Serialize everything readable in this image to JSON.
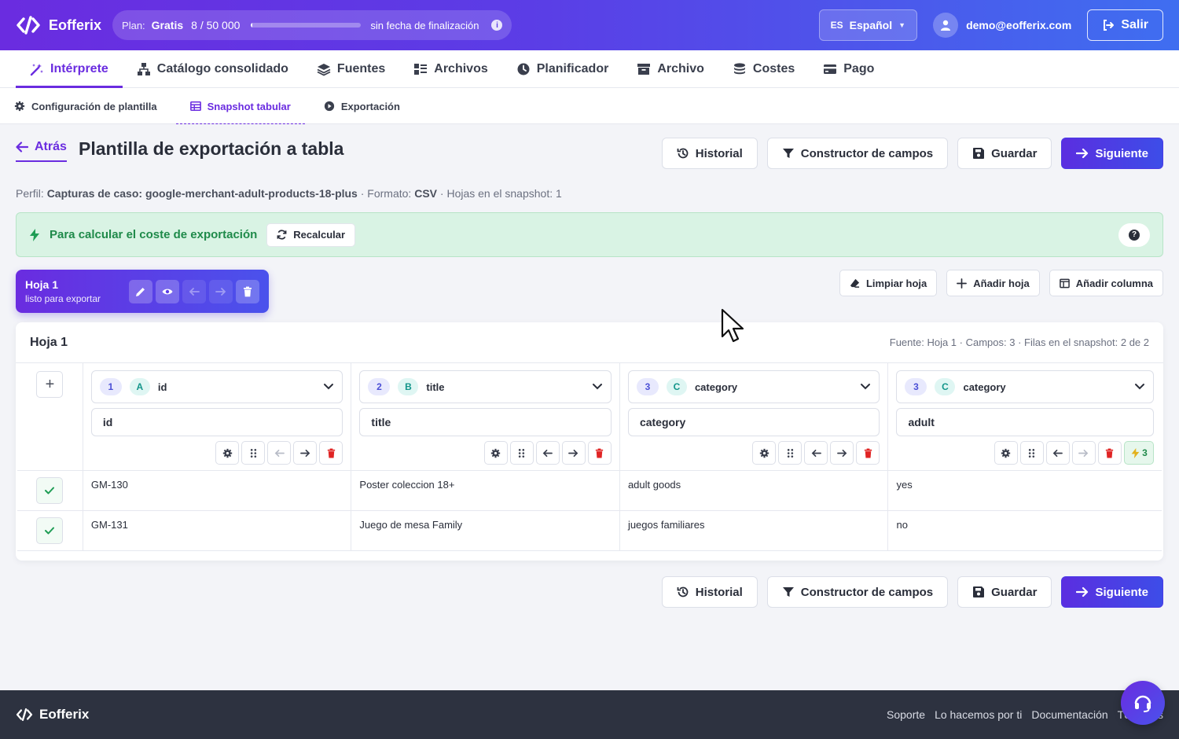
{
  "app": {
    "name": "Eofferix"
  },
  "plan": {
    "label": "Plan:",
    "name": "Gratis",
    "count": "8 / 50 000",
    "usage_fraction": 0.0002,
    "expiry": "sin fecha de finalización"
  },
  "language": {
    "code": "ES",
    "name": "Español"
  },
  "user": {
    "email": "demo@eofferix.com",
    "logout": "Salir"
  },
  "main_nav": [
    {
      "label": "Intérprete",
      "icon": "magic-wand-icon",
      "active": true
    },
    {
      "label": "Catálogo consolidado",
      "icon": "sitemap-icon"
    },
    {
      "label": "Fuentes",
      "icon": "layers-icon"
    },
    {
      "label": "Archivos",
      "icon": "files-icon"
    },
    {
      "label": "Planificador",
      "icon": "clock-icon"
    },
    {
      "label": "Archivo",
      "icon": "archive-icon"
    },
    {
      "label": "Costes",
      "icon": "coins-icon"
    },
    {
      "label": "Pago",
      "icon": "credit-card-icon"
    }
  ],
  "sub_nav": [
    {
      "label": "Configuración de plantilla",
      "icon": "gear-icon"
    },
    {
      "label": "Snapshot tabular",
      "icon": "table-icon",
      "active": true
    },
    {
      "label": "Exportación",
      "icon": "play-circle-icon"
    }
  ],
  "header": {
    "back": "Atrás",
    "title": "Plantilla de exportación a tabla",
    "history": "Historial",
    "field_builder": "Constructor de campos",
    "save": "Guardar",
    "next": "Siguiente"
  },
  "profile_line": {
    "profile_label": "Perfil:",
    "profile_value": "Capturas de caso: google-merchant-adult-products-18-plus",
    "format_label": "· Formato:",
    "format_value": "CSV",
    "sheets": "· Hojas en el snapshot: 1"
  },
  "alert": {
    "message": "Para calcular el coste de exportación",
    "recalc": "Recalcular",
    "help": "?"
  },
  "sheet_card": {
    "name": "Hoja 1",
    "status": "listo para exportar"
  },
  "sheet_actions": {
    "clear": "Limpiar hoja",
    "add_sheet": "Añadir hoja",
    "add_column": "Añadir columna"
  },
  "table": {
    "title": "Hoja 1",
    "meta": "Fuente: Hoja 1 · Campos: 3 · Filas en el snapshot: 2 de 2",
    "add_button": "+",
    "columns": [
      {
        "num": "1",
        "letter": "A",
        "source": "id",
        "name": "id"
      },
      {
        "num": "2",
        "letter": "B",
        "source": "title",
        "name": "title"
      },
      {
        "num": "3",
        "letter": "C",
        "source": "category",
        "name": "category"
      },
      {
        "num": "3",
        "letter": "C",
        "source": "category",
        "name": "adult",
        "rule_count": "3"
      }
    ],
    "rows": [
      [
        "GM-130",
        "Poster coleccion 18+",
        "adult goods",
        "yes"
      ],
      [
        "GM-131",
        "Juego de mesa Family",
        "juegos familiares",
        "no"
      ]
    ]
  },
  "footer": {
    "brand": "Eofferix",
    "links": [
      "Soporte",
      "Lo hacemos por ti",
      "Documentación",
      "Términos"
    ]
  },
  "colors": {
    "accent": "#6a2ce0",
    "success": "#1f8a4a",
    "danger": "#e02424"
  }
}
